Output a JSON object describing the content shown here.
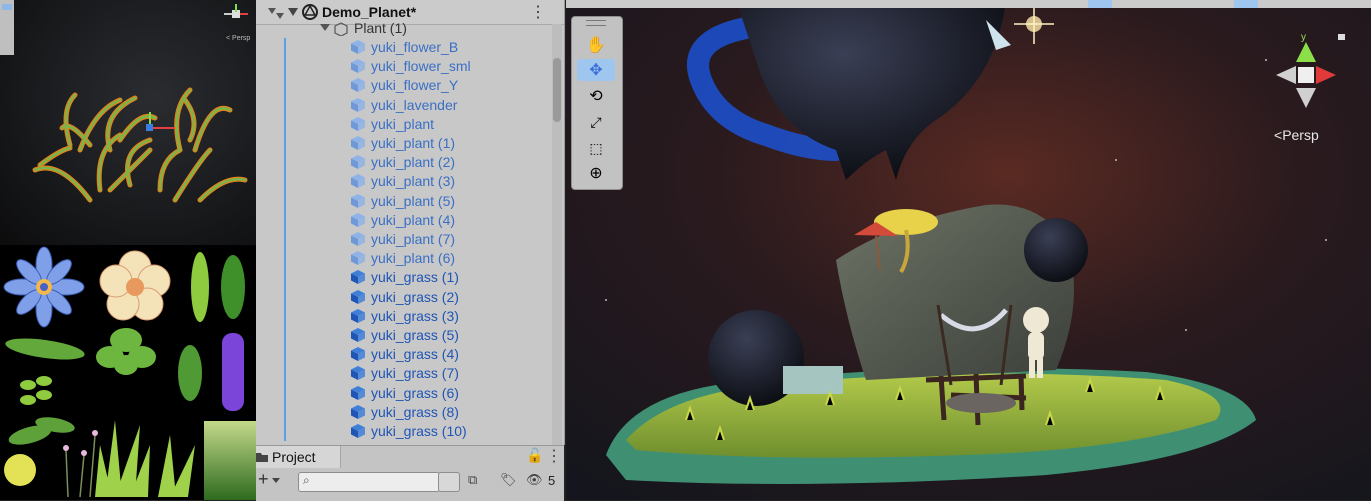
{
  "hierarchy": {
    "scene_name": "Demo_Planet*",
    "parent_object": "Plant (1)",
    "items": [
      {
        "label": "yuki_flower_B",
        "kind": "prefab-faded"
      },
      {
        "label": "yuki_flower_sml",
        "kind": "prefab-faded"
      },
      {
        "label": "yuki_flower_Y",
        "kind": "prefab-faded"
      },
      {
        "label": "yuki_lavender",
        "kind": "prefab-faded"
      },
      {
        "label": "yuki_plant",
        "kind": "prefab-faded"
      },
      {
        "label": "yuki_plant (1)",
        "kind": "prefab-faded"
      },
      {
        "label": "yuki_plant (2)",
        "kind": "prefab-faded"
      },
      {
        "label": "yuki_plant (3)",
        "kind": "prefab-faded"
      },
      {
        "label": "yuki_plant (5)",
        "kind": "prefab-faded"
      },
      {
        "label": "yuki_plant (4)",
        "kind": "prefab-faded"
      },
      {
        "label": "yuki_plant (7)",
        "kind": "prefab-faded"
      },
      {
        "label": "yuki_plant (6)",
        "kind": "prefab-faded"
      },
      {
        "label": "yuki_grass (1)",
        "kind": "prefab"
      },
      {
        "label": "yuki_grass (2)",
        "kind": "prefab"
      },
      {
        "label": "yuki_grass (3)",
        "kind": "prefab"
      },
      {
        "label": "yuki_grass (5)",
        "kind": "prefab"
      },
      {
        "label": "yuki_grass (4)",
        "kind": "prefab"
      },
      {
        "label": "yuki_grass (7)",
        "kind": "prefab"
      },
      {
        "label": "yuki_grass (6)",
        "kind": "prefab"
      },
      {
        "label": "yuki_grass (8)",
        "kind": "prefab"
      },
      {
        "label": "yuki_grass (10)",
        "kind": "prefab"
      }
    ]
  },
  "project": {
    "tab_label": "Project",
    "add_label": "+",
    "hidden_count": "5",
    "search_placeholder": ""
  },
  "scene": {
    "persp_label": "Persp",
    "gizmo_y_label": "y"
  },
  "gizmo_mini_label": "< Persp",
  "colors": {
    "hierarchy_bg": "#c8c8c8",
    "selected_tool": "#9fc6ef",
    "prefab_blue": "#1f55b5",
    "prefab_faded": "#3a6fc4"
  }
}
